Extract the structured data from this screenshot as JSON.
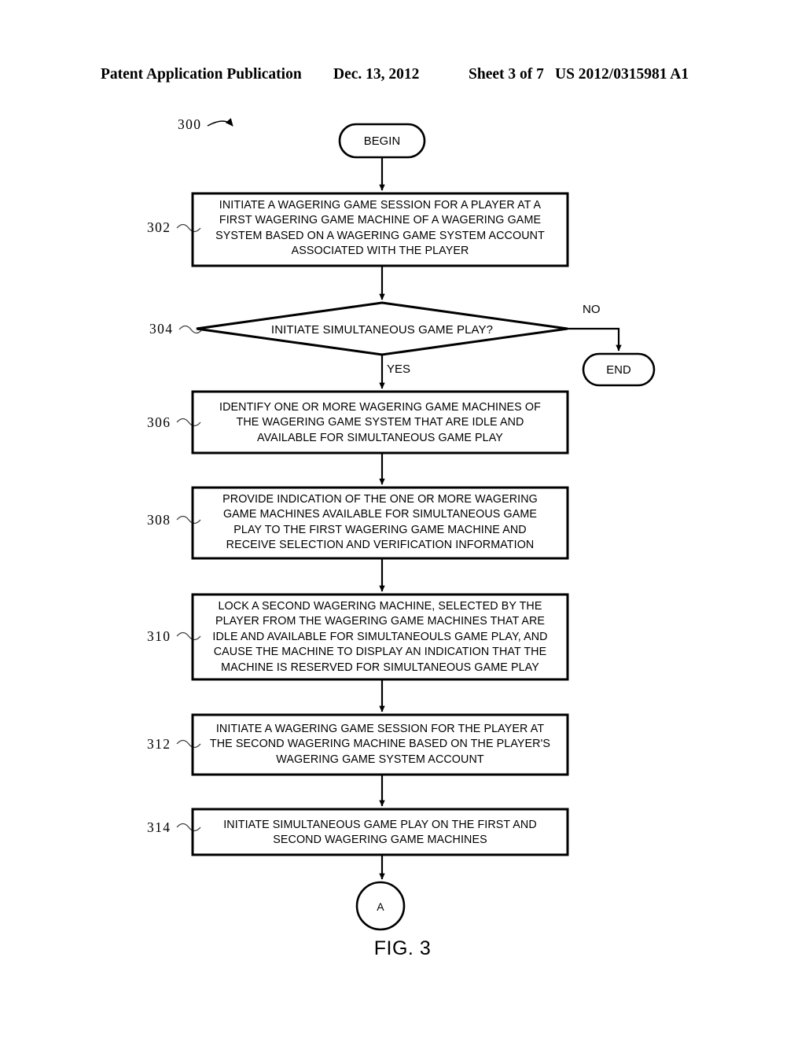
{
  "header": {
    "publication": "Patent Application Publication",
    "date": "Dec. 13, 2012",
    "sheet": "Sheet 3 of 7",
    "number": "US 2012/0315981 A1"
  },
  "figure": {
    "caption": "FIG. 3",
    "diagram_ref": "300"
  },
  "flowchart": {
    "type": "flowchart",
    "nodes": [
      {
        "id": "begin",
        "shape": "terminator",
        "ref": "",
        "text": "BEGIN"
      },
      {
        "id": "step302",
        "shape": "process",
        "ref": "302",
        "text": "INITIATE A WAGERING GAME SESSION FOR A PLAYER AT A\nFIRST WAGERING GAME MACHINE OF A WAGERING GAME\nSYSTEM BASED ON A WAGERING GAME SYSTEM ACCOUNT\nASSOCIATED WITH THE PLAYER"
      },
      {
        "id": "step304",
        "shape": "decision",
        "ref": "304",
        "text": "INITIATE SIMULTANEOUS GAME PLAY?"
      },
      {
        "id": "end",
        "shape": "terminator",
        "ref": "",
        "text": "END"
      },
      {
        "id": "step306",
        "shape": "process",
        "ref": "306",
        "text": "IDENTIFY ONE OR MORE WAGERING GAME MACHINES OF\nTHE WAGERING GAME SYSTEM THAT ARE IDLE AND\nAVAILABLE FOR SIMULTANEOUS GAME PLAY"
      },
      {
        "id": "step308",
        "shape": "process",
        "ref": "308",
        "text": "PROVIDE INDICATION OF THE ONE OR MORE WAGERING\nGAME MACHINES AVAILABLE FOR SIMULTANEOUS GAME\nPLAY TO THE FIRST WAGERING GAME MACHINE AND\nRECEIVE SELECTION AND VERIFICATION INFORMATION"
      },
      {
        "id": "step310",
        "shape": "process",
        "ref": "310",
        "text": "LOCK A SECOND WAGERING MACHINE, SELECTED BY THE\nPLAYER FROM THE WAGERING GAME MACHINES THAT ARE\nIDLE AND AVAILABLE FOR SIMULTANEOULS GAME PLAY, AND\nCAUSE THE MACHINE TO DISPLAY AN INDICATION THAT THE\nMACHINE IS RESERVED FOR SIMULTANEOUS GAME PLAY"
      },
      {
        "id": "step312",
        "shape": "process",
        "ref": "312",
        "text": "INITIATE A WAGERING GAME SESSION FOR THE PLAYER AT\nTHE SECOND WAGERING MACHINE BASED ON THE PLAYER'S\nWAGERING GAME SYSTEM ACCOUNT"
      },
      {
        "id": "step314",
        "shape": "process",
        "ref": "314",
        "text": "INITIATE SIMULTANEOUS GAME PLAY ON THE FIRST AND\nSECOND WAGERING GAME MACHINES"
      },
      {
        "id": "connectorA",
        "shape": "connector",
        "ref": "",
        "text": "A"
      }
    ],
    "edge_labels": {
      "yes": "YES",
      "no": "NO"
    }
  },
  "colors": {
    "stroke": "#000000",
    "background": "#ffffff",
    "text": "#000000"
  }
}
